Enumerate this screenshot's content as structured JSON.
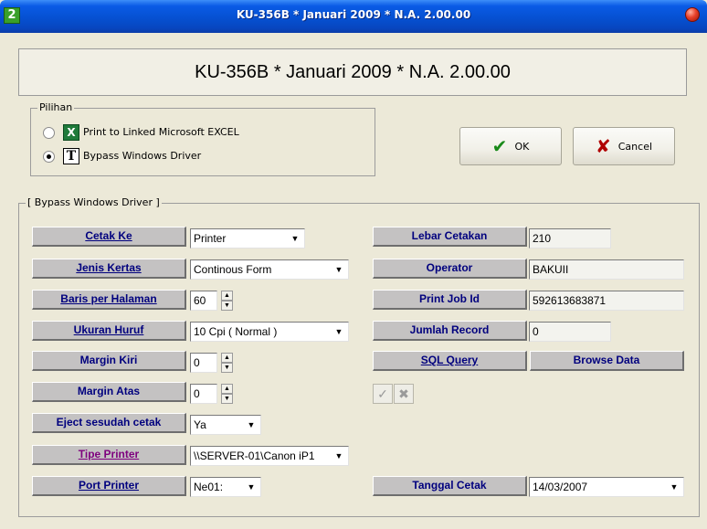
{
  "window": {
    "title": "KU-356B * Januari 2009 * N.A. 2.00.00",
    "app_icon_text": "2",
    "header_title": "KU-356B * Januari 2009 * N.A. 2.00.00"
  },
  "pilihan": {
    "legend": "Pilihan",
    "options": [
      {
        "icon": "excel-icon",
        "icon_text": "X",
        "label": "Print to Linked Microsoft EXCEL",
        "selected": false
      },
      {
        "icon": "text-t-icon",
        "icon_text": "T",
        "label": "Bypass Windows Driver",
        "selected": true
      }
    ]
  },
  "buttons": {
    "ok": "OK",
    "cancel": "Cancel",
    "ok_icon": "✔",
    "cancel_icon": "✘"
  },
  "bypass": {
    "legend": "[ Bypass Windows Driver ]",
    "left": [
      {
        "label": "Cetak Ke",
        "value": "Printer",
        "control": "combo"
      },
      {
        "label": "Jenis Kertas",
        "value": "Continous Form",
        "control": "combo"
      },
      {
        "label": "Baris per Halaman",
        "value": "60",
        "control": "spin"
      },
      {
        "label": "Ukuran Huruf",
        "value": "10 Cpi ( Normal )",
        "control": "combo"
      },
      {
        "label": "Margin Kiri",
        "value": "0",
        "control": "spin"
      },
      {
        "label": "Margin Atas",
        "value": "0",
        "control": "spin"
      },
      {
        "label": "Eject sesudah cetak",
        "value": "Ya",
        "control": "combo"
      },
      {
        "label": "Tipe Printer",
        "value": "\\\\SERVER-01\\Canon iP1",
        "control": "combo"
      },
      {
        "label": "Port Printer",
        "value": "Ne01:",
        "control": "combo"
      }
    ],
    "right": [
      {
        "label": "Lebar Cetakan",
        "value": "210"
      },
      {
        "label": "Operator",
        "value": "BAKUII"
      },
      {
        "label": "Print Job Id",
        "value": "592613683871"
      },
      {
        "label": "Jumlah Record",
        "value": "0"
      }
    ],
    "sql_query": "SQL Query",
    "browse_data": "Browse Data",
    "tanggal_label": "Tanggal Cetak",
    "tanggal_value": "14/03/2007"
  },
  "colors": {
    "label_text": "#00007e",
    "label_text_alt": "#7e007e",
    "titlebar": "#0652d4"
  }
}
